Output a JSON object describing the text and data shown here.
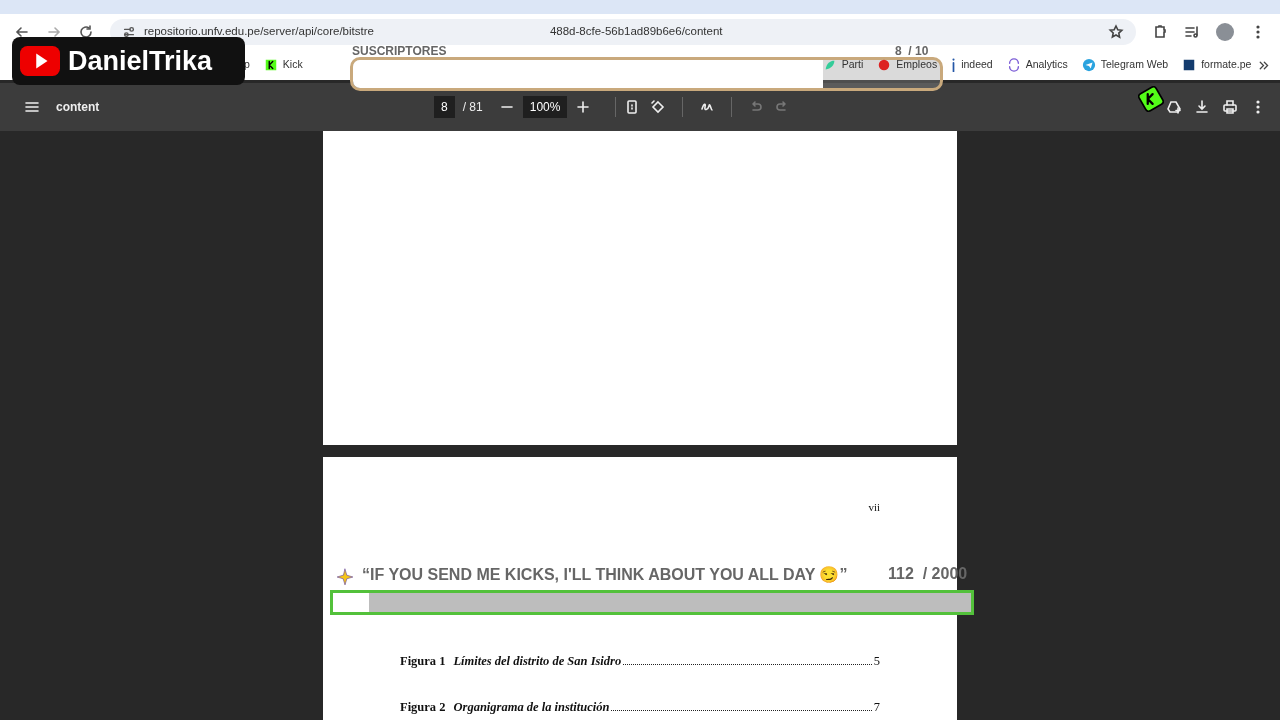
{
  "browser": {
    "url_visible_start": "repositorio.unfv.edu.pe/server/api/core/bitstre",
    "url_visible_end": "488d-8cfe-56b1ad89b6e6/content",
    "bookmarks_left": [
      {
        "label": "p"
      },
      {
        "label": "Kick"
      }
    ],
    "bookmarks_right": [
      {
        "label": "Parti"
      },
      {
        "label": "Empleos"
      },
      {
        "label": "indeed"
      },
      {
        "label": "Analytics"
      },
      {
        "label": "Telegram Web"
      },
      {
        "label": "formate.pe"
      }
    ]
  },
  "pdf_toolbar": {
    "title": "content",
    "page": "8",
    "page_total": "/ 81",
    "zoom": "100%",
    "undo_disabled": true,
    "redo_disabled": true
  },
  "document": {
    "page_number": "vii",
    "figures": [
      {
        "label": "Figura 1",
        "title": "Límites del distrito de San Isidro",
        "page": "5"
      },
      {
        "label": "Figura 2",
        "title": "Organigrama de la institución",
        "page": "7"
      }
    ]
  },
  "stream_overlay": {
    "channel": "DanielTrika",
    "subscriber_goal": {
      "title": "SUSCRIPTORES",
      "count": "8  / 10",
      "level": 0.8
    },
    "kicks_goal": {
      "title": "“IF YOU SEND ME KICKS, I'LL THINK ABOUT YOU ALL DAY 😏”",
      "count": "112  / 2000",
      "level": 0.056
    }
  }
}
